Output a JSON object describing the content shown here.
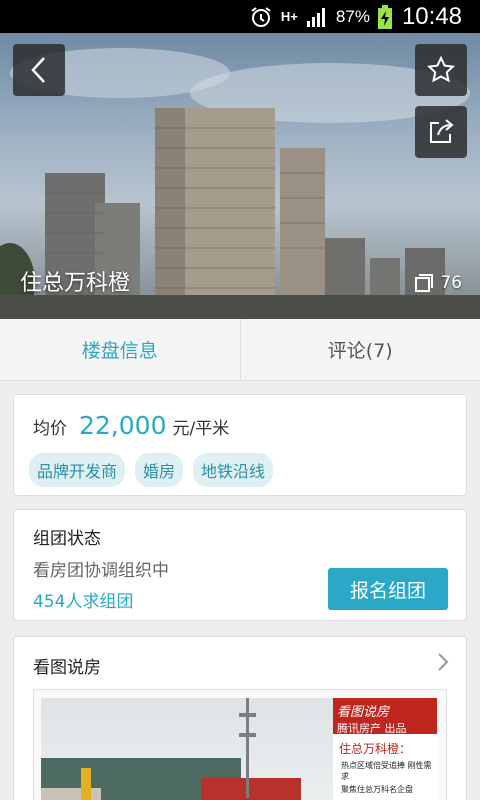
{
  "status_bar": {
    "network": "H+",
    "battery_percent": "87%",
    "time": "10:48"
  },
  "hero": {
    "title": "住总万科橙",
    "photo_count": "76",
    "icons": [
      "back-icon",
      "star-icon",
      "share-icon",
      "photo-stack-icon"
    ]
  },
  "tabs": [
    {
      "label": "楼盘信息",
      "active": true
    },
    {
      "label": "评论(7)",
      "active": false
    }
  ],
  "price": {
    "label": "均价",
    "value": "22,000",
    "unit": "元/平米",
    "tags": [
      "品牌开发商",
      "婚房",
      "地铁沿线"
    ]
  },
  "group": {
    "title": "组团状态",
    "status": "看房团协调组织中",
    "count": "454人求组团",
    "button": "报名组团"
  },
  "picture_story": {
    "title": "看图说房",
    "promo": {
      "brand": "看图说房",
      "source_left": "腾讯房产",
      "source_right": "出品",
      "name": "住总万科橙：",
      "line1": "热点区域倍受追捧 刚性需求",
      "line2": "聚焦住总万科名企盘"
    }
  },
  "colors": {
    "accent": "#2aa8c8",
    "tag_bg": "#dff0f3",
    "promo_red": "#c0261e"
  }
}
